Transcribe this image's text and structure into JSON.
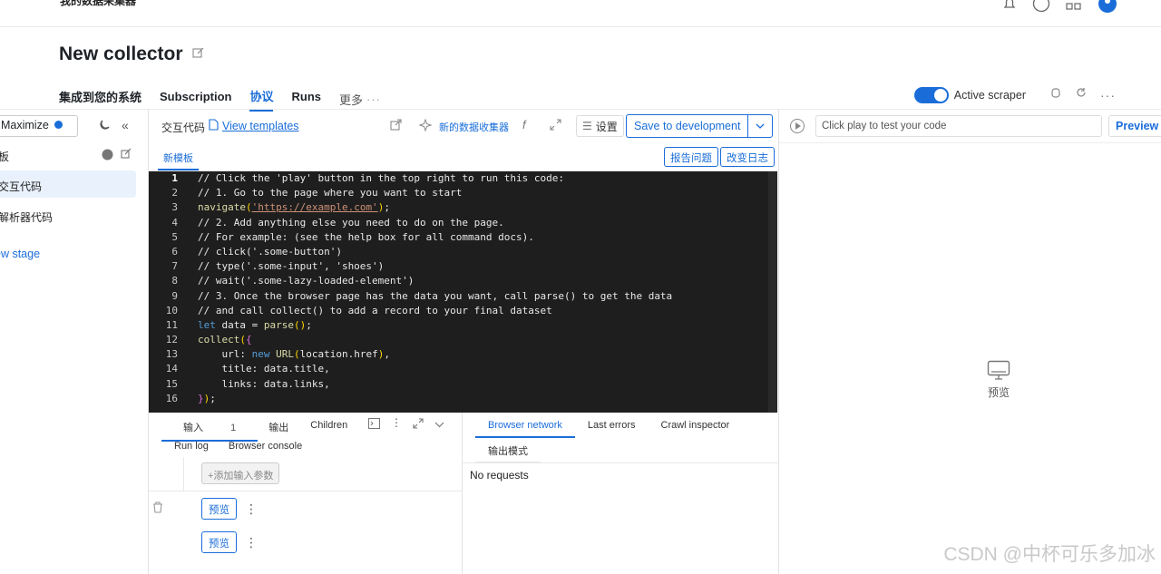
{
  "topbar": {
    "app_title": "我的数据采集器"
  },
  "page": {
    "title": "New collector"
  },
  "tabs": [
    {
      "label": "集成到您的系统"
    },
    {
      "label": "Subscription"
    },
    {
      "label": "协议"
    },
    {
      "label": "Runs"
    },
    {
      "label": "更多"
    }
  ],
  "header_right": {
    "active_label": "Active scraper"
  },
  "sidebar": {
    "maximize": "Maximize",
    "row1": "板",
    "item1": "交互代码",
    "item2": "解析器代码",
    "new_stage": "ew stage"
  },
  "editor": {
    "label": "交互代码",
    "view_templates": "View templates",
    "new_collector": "新的数据收集器",
    "fx": "f",
    "settings": "设置",
    "save": "Save to development",
    "subtab": "新模板",
    "report": "报告问题",
    "changelog": "改变日志"
  },
  "code_lines": [
    "1",
    "2",
    "3",
    "4",
    "5",
    "6",
    "7",
    "8",
    "9",
    "10",
    "11",
    "12",
    "13",
    "14",
    "15",
    "16"
  ],
  "code": {
    "l1": "// Click the 'play' button in the top right to run this code:",
    "l2": "// 1. Go to the page where you want to start",
    "l3a": "navigate",
    "l3b": "'https://example.com'",
    "l4": "// 2. Add anything else you need to do on the page.",
    "l5": "// For example: (see the help box for all command docs).",
    "l6": "// click('.some-button')",
    "l7": "// type('.some-input', 'shoes')",
    "l8": "// wait('.some-lazy-loaded-element')",
    "l9": "// 3. Once the browser page has the data you want, call parse() to get the data",
    "l10": "// and call collect() to add a record to your final dataset",
    "l11a": "let",
    "l11b": " data = ",
    "l11c": "parse",
    "l12a": "collect",
    "l13a": "    url: ",
    "l13b": "new",
    "l13c": "URL",
    "l13d": "location.href",
    "l14": "    title: data.title,",
    "l15": "    links: data.links,"
  },
  "bottom_left": {
    "tab_input": "输入",
    "tab_input_count": "1",
    "tab_output": "输出",
    "tab_children": "Children",
    "tab_runlog": "Run log",
    "tab_console": "Browser console",
    "add_param": "添加输入参数",
    "preview1": "预览",
    "preview2": "预览"
  },
  "bottom_right": {
    "tab_network": "Browser network",
    "tab_errors": "Last errors",
    "tab_crawl": "Crawl inspector",
    "output_mode": "输出模式",
    "no_requests": "No requests"
  },
  "preview_panel": {
    "input_value": "Click play to test your code",
    "preview_btn": "Preview",
    "center_label": "预览"
  },
  "watermark": "CSDN @中杯可乐多加冰",
  "colors": {
    "accent": "#1a6dd9",
    "editor_bg": "#1e1e1e"
  }
}
